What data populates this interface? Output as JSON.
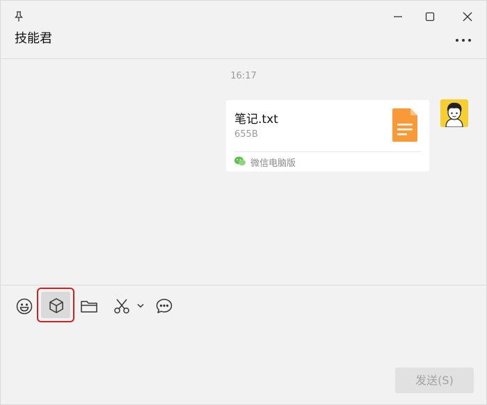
{
  "header": {
    "title": "技能君",
    "icons": [
      "pin-icon",
      "minimize-icon",
      "maximize-icon",
      "close-icon",
      "more-icon"
    ]
  },
  "chat": {
    "timestamp": "16:17",
    "message": {
      "file_name": "笔记.txt",
      "file_size": "655B",
      "source": "微信电脑版",
      "file_icon": "text-file-icon"
    }
  },
  "toolbar": {
    "tools": [
      "emoji-icon",
      "favorites-icon",
      "folder-icon",
      "screenshot-icon",
      "chevron-down-icon",
      "chat-history-icon"
    ],
    "highlighted": "favorites-icon"
  },
  "compose": {
    "send_label": "发送(S)"
  },
  "colors": {
    "background": "#f2f2f2",
    "file_icon": "#f79a37",
    "avatar_bg": "#f7cf2e",
    "highlight_border": "#d21f1f",
    "wechat_green": "#5fbf4e"
  }
}
